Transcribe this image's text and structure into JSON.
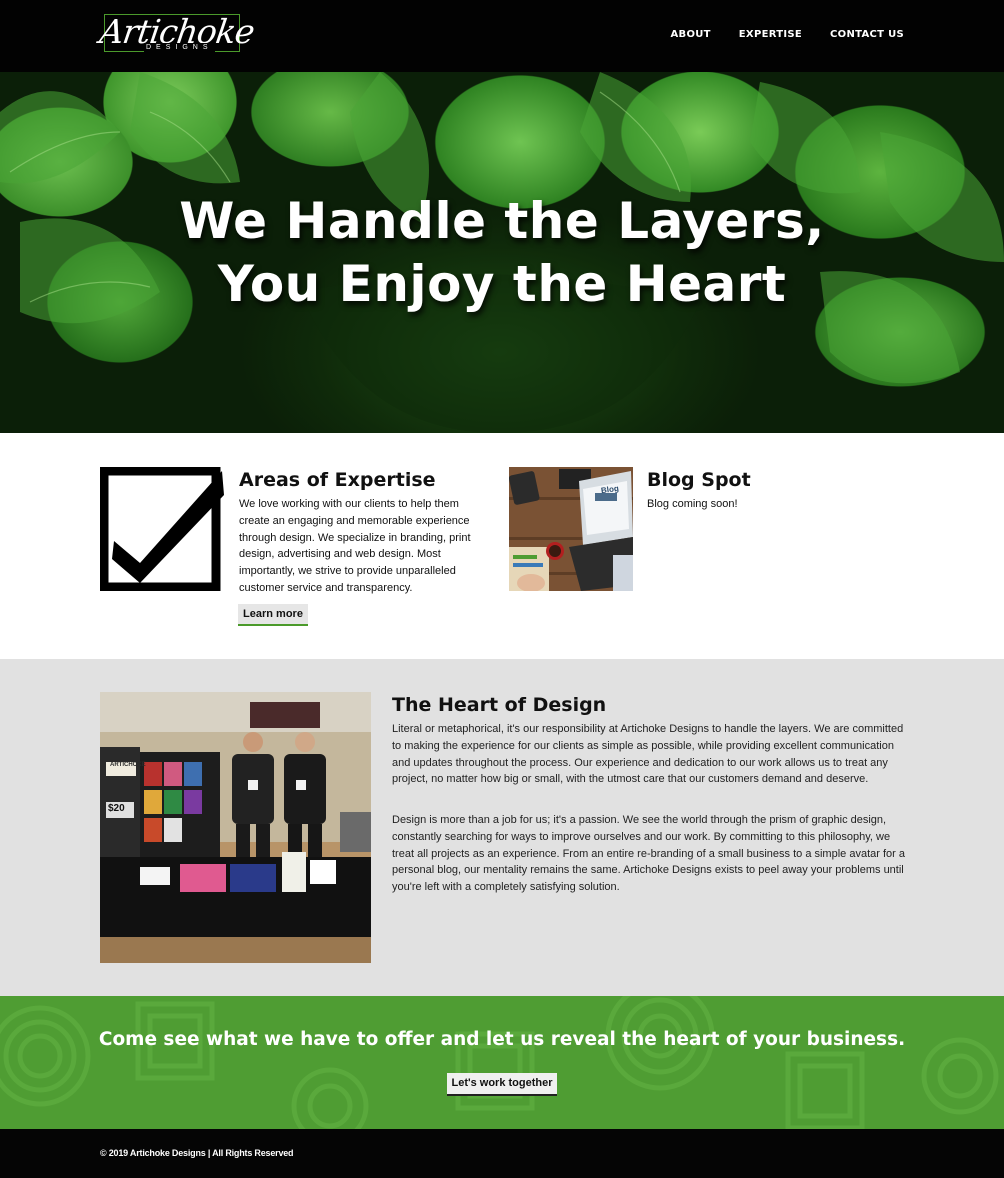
{
  "header": {
    "logo": {
      "script": "Artichoke",
      "sub": "DESIGNS"
    },
    "nav": [
      {
        "label": "ABOUT"
      },
      {
        "label": "EXPERTISE"
      },
      {
        "label": "CONTACT US"
      }
    ]
  },
  "hero": {
    "line1": "We Handle the Layers,",
    "line2": "You Enjoy the Heart"
  },
  "features": {
    "expertise": {
      "title": "Areas of Expertise",
      "text": "We love working with our clients to help them create an engaging and memorable experience through design. We specialize in branding, print design, advertising and web design. Most importantly, we strive to provide unparalleled customer service and transparency.",
      "button": "Learn more",
      "icon": "checkbox-checked-icon"
    },
    "blog": {
      "title": "Blog Spot",
      "text": "Blog coming soon!",
      "image_label": "Blog"
    }
  },
  "heart": {
    "title": "The Heart of Design",
    "p1": "Literal or metaphorical, it's our responsibility at Artichoke Designs to handle the layers. We are committed to making the experience for our clients as simple as possible, while providing excellent communication and updates throughout the process. Our experience and dedication to our work allows us to treat any project, no matter how big or small, with the utmost care that our customers demand and deserve.",
    "p2": "Design is more than a job for us; it's a passion. We see the world through the prism of graphic design, constantly searching for ways to improve ourselves and our work. By committing to this philosophy, we treat all projects as an experience. From an entire re-branding of a small business to a simple avatar for a personal blog, our mentality remains the same. Artichoke Designs exists to peel away your problems until you're left with a completely satisfying solution.",
    "photo_banner": "ARTICHOKE",
    "photo_price": "$20"
  },
  "cta": {
    "text": "Come see what we have to offer and let us reveal the heart of your business.",
    "button": "Let's work together"
  },
  "footer": {
    "copyright": "© 2019 Artichoke Designs | All Rights Reserved"
  },
  "colors": {
    "accent_green": "#4f9d33",
    "header_bg": "#020202",
    "section_gray": "#e1e1e1"
  }
}
